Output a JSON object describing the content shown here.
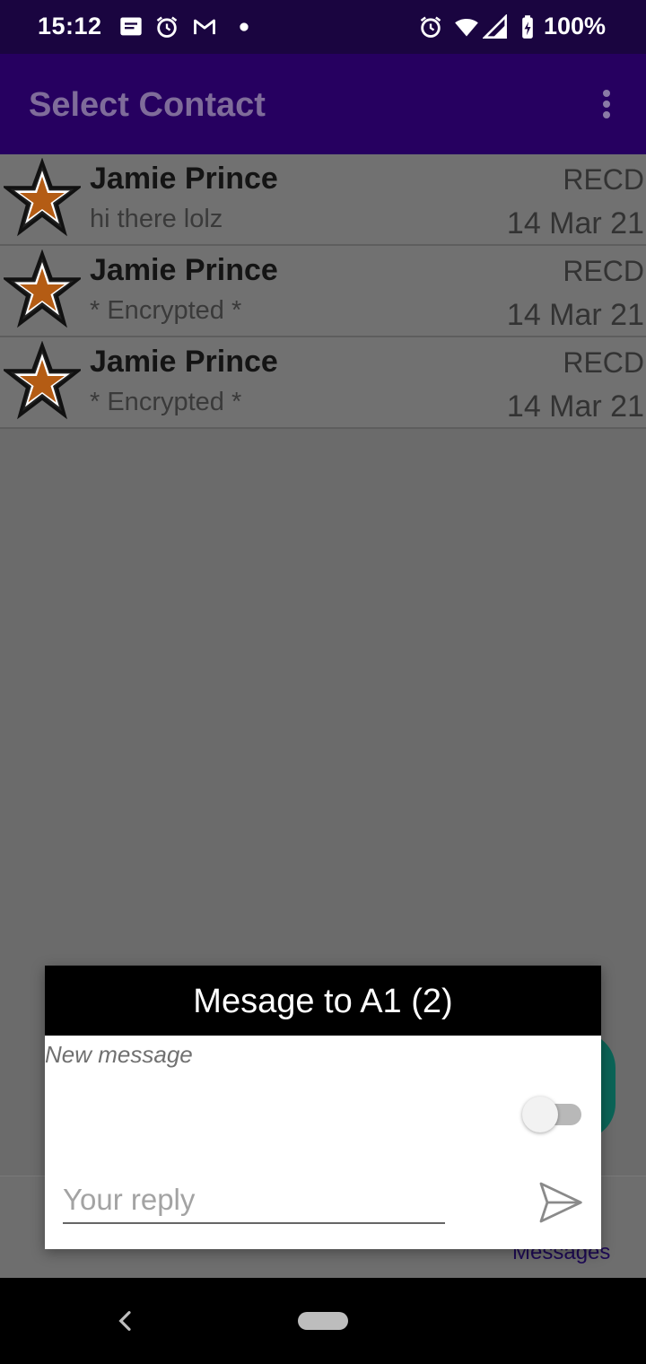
{
  "status_bar": {
    "time": "15:12",
    "left_icons": [
      "message-icon",
      "alarm-icon",
      "gmail-icon",
      "dot-icon"
    ],
    "right_icons": [
      "alarm-icon",
      "wifi-icon",
      "signal-icon",
      "battery-icon"
    ],
    "battery": "100%"
  },
  "app_bar": {
    "title": "Select Contact",
    "menu_icon": "more-vert-icon"
  },
  "contacts": [
    {
      "name": "Jamie Prince",
      "preview": "hi there lolz",
      "status": "RECD",
      "date": "14 Mar 21",
      "icon": "star-icon"
    },
    {
      "name": "Jamie Prince",
      "preview": "* Encrypted *",
      "status": "RECD",
      "date": "14 Mar 21",
      "icon": "star-icon"
    },
    {
      "name": "Jamie Prince",
      "preview": "* Encrypted *",
      "status": "RECD",
      "date": "14 Mar 21",
      "icon": "star-icon"
    }
  ],
  "bottom_nav": {
    "label": "Messages"
  },
  "dialog": {
    "title": "Mesage to A1 (2)",
    "subtitle": "New message",
    "toggle_on": false,
    "reply_placeholder": "Your reply",
    "reply_value": "",
    "send_icon": "send-icon"
  },
  "colors": {
    "status_bar": "#1a0540",
    "app_bar": "#260060",
    "dialog_header": "#000000",
    "fab": "#0b6457",
    "star_fill": "#b45c14"
  }
}
